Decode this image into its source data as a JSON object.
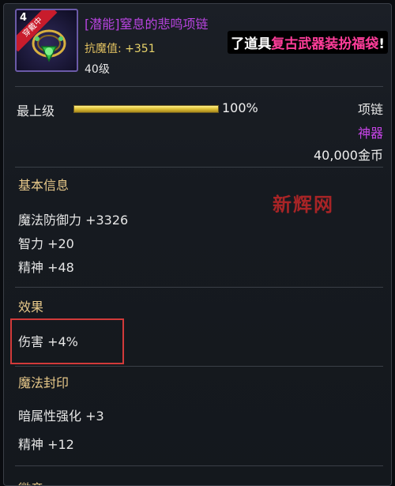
{
  "item": {
    "icon_level": "4",
    "icon_ribbon": "穿戴中",
    "title": "[潜能]窒息的悲鸣项链",
    "resist_label": "抗魔值: ",
    "resist_value": "+351",
    "level": "40级",
    "icon": "necklace-icon"
  },
  "promo": {
    "white": "了道具",
    "pink": "复古武器装扮福袋",
    "suffix": "!"
  },
  "durability": {
    "label": "最上级",
    "percent_text": "100%",
    "value": 1.0
  },
  "meta": {
    "slot": "项链",
    "rarity": "神器",
    "price": "40,000金币"
  },
  "sections": {
    "basic": {
      "title": "基本信息",
      "stats": [
        "魔法防御力 +3326",
        "智力 +20",
        "精神 +48"
      ]
    },
    "effect": {
      "title": "效果",
      "stats": [
        "伤害 +4%"
      ]
    },
    "seal": {
      "title": "魔法封印",
      "stats": [
        "暗属性强化 +3",
        "精神 +12"
      ]
    },
    "next": {
      "title": "徽章"
    }
  },
  "watermark": "新辉网",
  "colors": {
    "title": "#b844e0",
    "rarity": "#c844e8",
    "section": "#e8c98a",
    "highlight": "#d23a3a",
    "promo_pink": "#ff3d9a"
  }
}
